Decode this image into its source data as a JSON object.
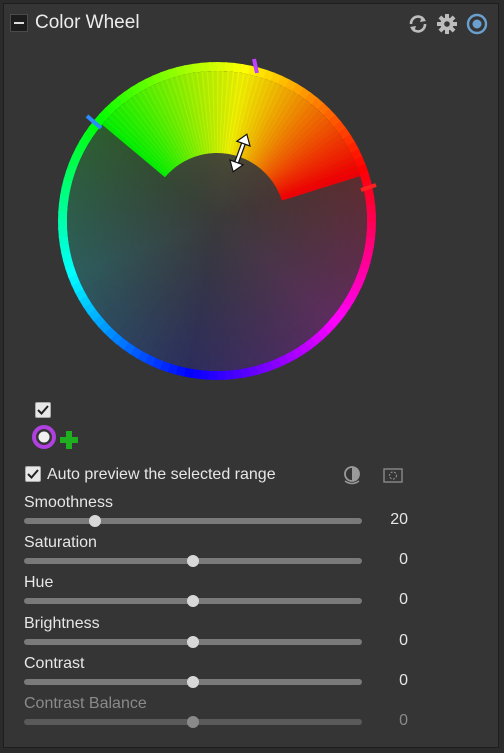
{
  "header": {
    "title": "Color Wheel",
    "icons": [
      "reset-icon",
      "gear-icon",
      "target-icon"
    ]
  },
  "wheel": {
    "accent_colors": [
      "#ff0000",
      "#ff00ff",
      "#0000ff",
      "#00ffff",
      "#00ff00",
      "#ffff00"
    ]
  },
  "range": {
    "enabled_checkbox": true,
    "picker_color": "#b040e0",
    "add_color": "#1fae1f"
  },
  "preview": {
    "label": "Auto preview the selected range",
    "checked": true
  },
  "sliders": [
    {
      "label": "Smoothness",
      "value": "20",
      "fraction": 0.21,
      "enabled": true
    },
    {
      "label": "Saturation",
      "value": "0",
      "fraction": 0.5,
      "enabled": true
    },
    {
      "label": "Hue",
      "value": "0",
      "fraction": 0.5,
      "enabled": true
    },
    {
      "label": "Brightness",
      "value": "0",
      "fraction": 0.5,
      "enabled": true
    },
    {
      "label": "Contrast",
      "value": "0",
      "fraction": 0.5,
      "enabled": true
    },
    {
      "label": "Contrast Balance",
      "value": "0",
      "fraction": 0.5,
      "enabled": false
    }
  ]
}
